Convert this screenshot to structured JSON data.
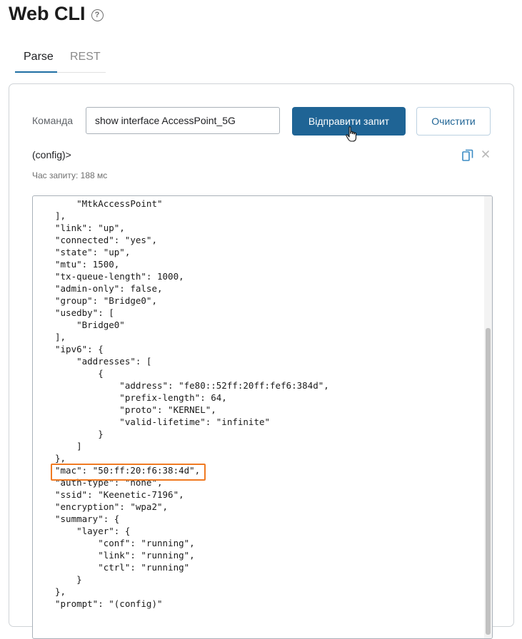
{
  "header": {
    "title": "Web CLI",
    "help_icon": "question-circle-icon"
  },
  "tabs": [
    {
      "label": "Parse",
      "active": true
    },
    {
      "label": "REST",
      "active": false
    }
  ],
  "form": {
    "command_label": "Команда",
    "command_value": "show interface AccessPoint_5G",
    "send_label": "Відправити запит",
    "clear_label": "Очистити"
  },
  "result": {
    "prompt": "(config)>",
    "request_time": "Час запиту: 188 мс",
    "copy_icon": "copy-icon",
    "close_icon": "close-icon",
    "highlighted_line": "\"mac\": \"50:ff:20:f6:38:4d\",",
    "output": "    \"AccessPoint\",\n    \"MtkAccessPoint\"\n],\n\"link\": \"up\",\n\"connected\": \"yes\",\n\"state\": \"up\",\n\"mtu\": 1500,\n\"tx-queue-length\": 1000,\n\"admin-only\": false,\n\"group\": \"Bridge0\",\n\"usedby\": [\n    \"Bridge0\"\n],\n\"ipv6\": {\n    \"addresses\": [\n        {\n            \"address\": \"fe80::52ff:20ff:fef6:384d\",\n            \"prefix-length\": 64,\n            \"proto\": \"KERNEL\",\n            \"valid-lifetime\": \"infinite\"\n        }\n    ]\n},\n\"mac\": \"50:ff:20:f6:38:4d\",\n\"auth-type\": \"none\",\n\"ssid\": \"Keenetic-7196\",\n\"encryption\": \"wpa2\",\n\"summary\": {\n    \"layer\": {\n        \"conf\": \"running\",\n        \"link\": \"running\",\n        \"ctrl\": \"running\"\n    }\n},\n\"prompt\": \"(config)\""
  },
  "colors": {
    "accent": "#1f6495",
    "highlight": "#f07a22"
  }
}
